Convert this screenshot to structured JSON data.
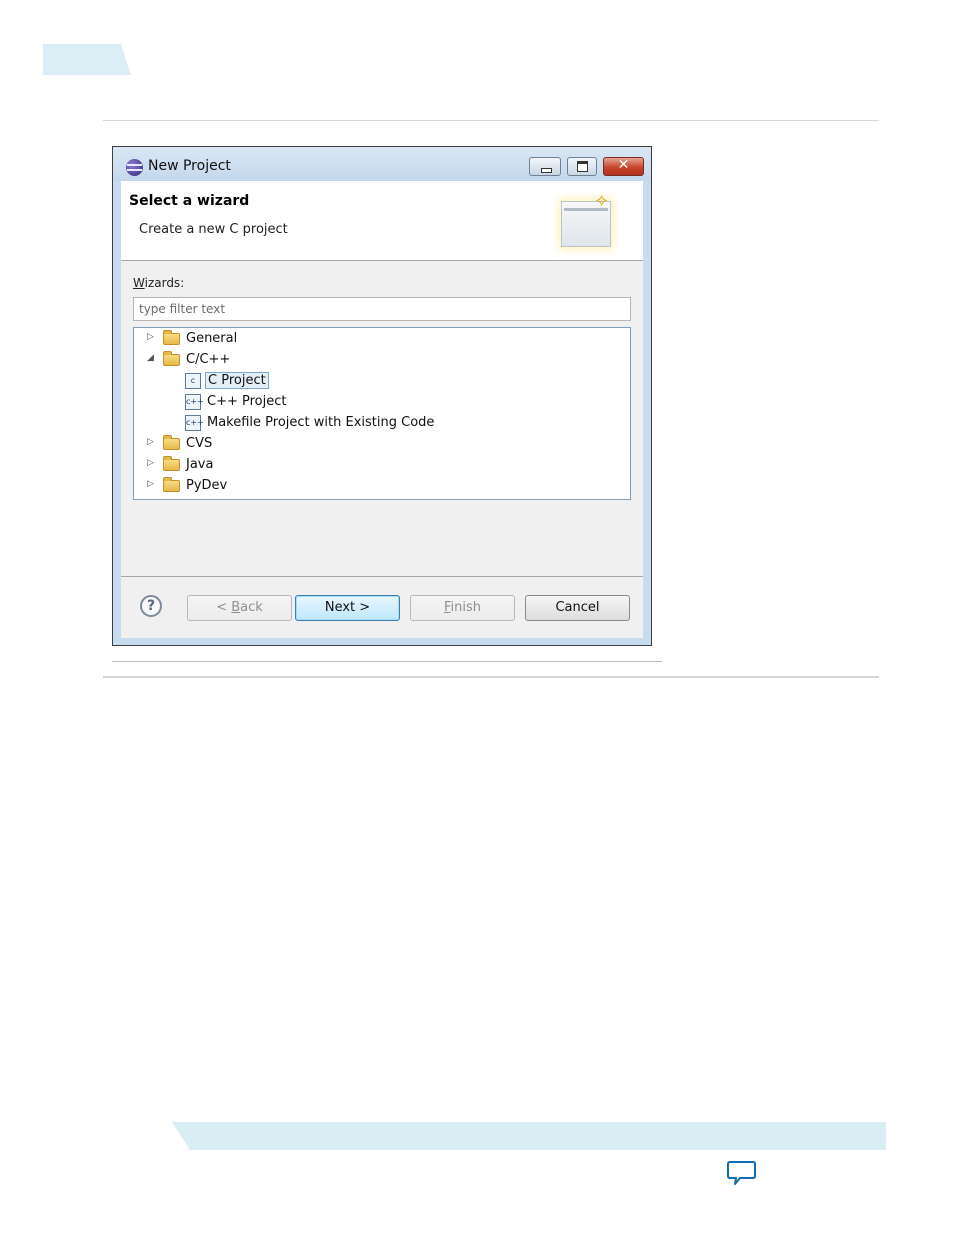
{
  "dialog": {
    "title": "New Project",
    "window_controls": {
      "minimize_icon": "minimize-icon",
      "maximize_icon": "maximize-icon",
      "close_icon": "close-icon",
      "close_glyph": "✕"
    },
    "banner": {
      "title": "Select a wizard",
      "subtitle": "Create a new C project",
      "graphic_icon": "new-wizard-graphic-icon"
    },
    "wizards_label_accel": "W",
    "wizards_label_rest": "izards:",
    "filter": {
      "placeholder": "type filter text",
      "value": ""
    },
    "tree": [
      {
        "label": "General",
        "kind": "folder",
        "expanded": false,
        "level": 0
      },
      {
        "label": "C/C++",
        "kind": "folder",
        "expanded": true,
        "level": 0
      },
      {
        "label": "C Project",
        "kind": "file",
        "icon_text": "c",
        "level": 1,
        "selected": true
      },
      {
        "label": "C++ Project",
        "kind": "file",
        "icon_text": "c++",
        "level": 1
      },
      {
        "label": "Makefile Project with Existing Code",
        "kind": "file",
        "icon_text": "c++",
        "level": 1
      },
      {
        "label": "CVS",
        "kind": "folder",
        "expanded": false,
        "level": 0
      },
      {
        "label": "Java",
        "kind": "folder",
        "expanded": false,
        "level": 0
      },
      {
        "label": "PyDev",
        "kind": "folder",
        "expanded": false,
        "level": 0
      }
    ],
    "buttons": {
      "help_glyph": "?",
      "back_prefix": "< ",
      "back_accel": "B",
      "back_rest": "ack",
      "next": "Next >",
      "finish_accel": "F",
      "finish_rest": "inish",
      "cancel": "Cancel"
    }
  },
  "colors": {
    "accent_band": "#d9edf4",
    "primary_button": "#bee6fd",
    "close_button": "#c8452c"
  }
}
